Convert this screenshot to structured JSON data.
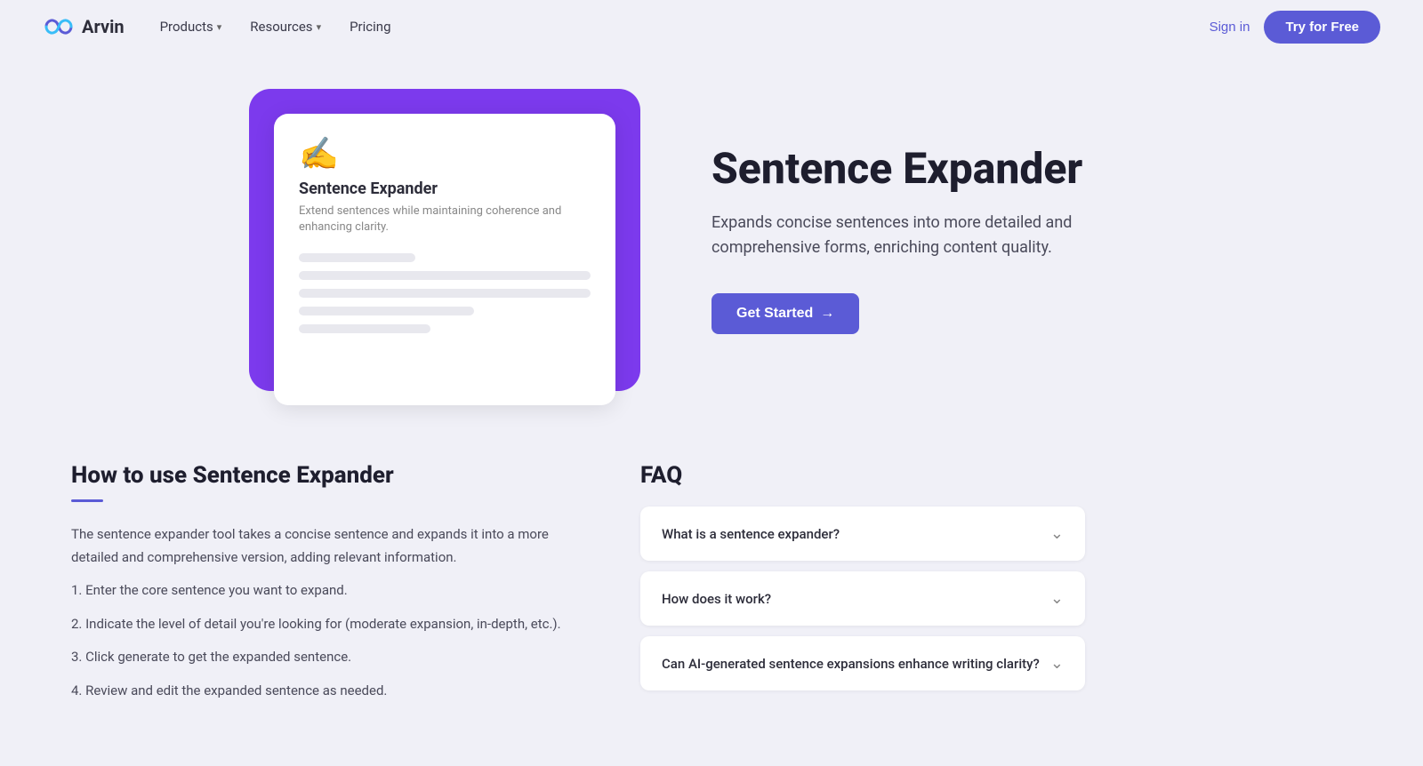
{
  "nav": {
    "logo_text": "Arvin",
    "products_label": "Products",
    "resources_label": "Resources",
    "pricing_label": "Pricing",
    "sign_in_label": "Sign in",
    "try_free_label": "Try for Free"
  },
  "hero": {
    "card": {
      "emoji": "✍️",
      "title": "Sentence Expander",
      "subtitle": "Extend sentences while maintaining coherence and enhancing clarity."
    },
    "title": "Sentence Expander",
    "description": "Expands concise sentences into more detailed and comprehensive forms, enriching content quality.",
    "get_started_label": "Get Started"
  },
  "how_to_use": {
    "title": "How to use Sentence Expander",
    "intro": "The sentence expander tool takes a concise sentence and expands it into a more detailed and comprehensive version, adding relevant information.",
    "steps": [
      "1. Enter the core sentence you want to expand.",
      "2. Indicate the level of detail you're looking for (moderate expansion, in-depth, etc.).",
      "3. Click generate to get the expanded sentence.",
      "4. Review and edit the expanded sentence as needed."
    ]
  },
  "faq": {
    "title": "FAQ",
    "items": [
      {
        "question": "What is a sentence expander?"
      },
      {
        "question": "How does it work?"
      },
      {
        "question": "Can AI-generated sentence expansions enhance writing clarity?"
      }
    ]
  },
  "colors": {
    "primary": "#5b5bd6",
    "card_bg": "#7c3aed"
  }
}
